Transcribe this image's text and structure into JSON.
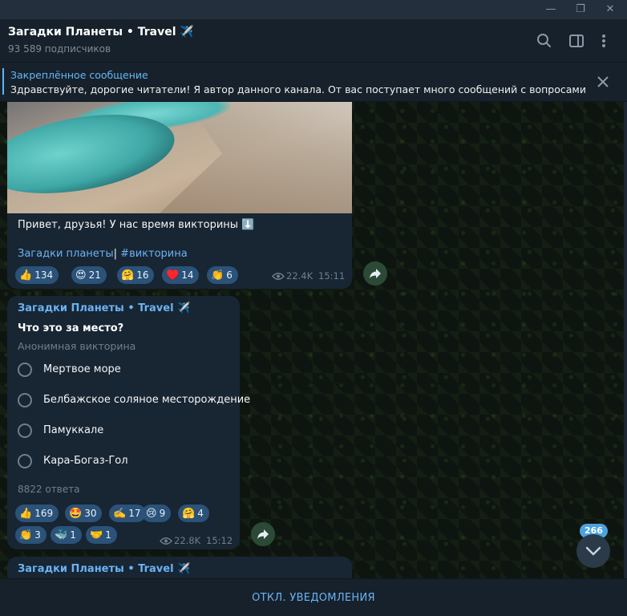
{
  "window": {
    "minimize": "—",
    "maximize": "❐",
    "close": "✕"
  },
  "header": {
    "title": "Загадки Планеты • Travel ✈️",
    "subtitle": "93 589 подписчиков"
  },
  "pinned": {
    "title": "Закреплённое сообщение",
    "text": "Здравствуйте, дорогие читатели! Я автор данного канала. От вас поступает много сообщений с вопросами к..."
  },
  "message1": {
    "text": "Привет, друзья! У нас время викторины ⬇️",
    "link1": "Загадки планеты",
    "separator": "|",
    "link2": "#викторина",
    "reactions": [
      {
        "emoji": "👍",
        "count": "134"
      },
      {
        "emoji": "😍",
        "count": "21"
      },
      {
        "emoji": "🤗",
        "count": "16"
      },
      {
        "emoji": "♥️",
        "count": "14"
      },
      {
        "emoji": "👏",
        "count": "6"
      }
    ],
    "views": "22.4K",
    "time": "15:11"
  },
  "message2": {
    "sender": "Загадки Планеты • Travel ✈️",
    "question": "Что это за место?",
    "quiz_type": "Анонимная викторина",
    "options": [
      "Мертвое море",
      "Белбажское соляное месторождение",
      "Памуккале",
      "Кара-Богаз-Гол"
    ],
    "answers": "8822 ответа",
    "reactions": [
      {
        "emoji": "👍",
        "count": "169"
      },
      {
        "emoji": "🤩",
        "count": "30"
      },
      {
        "emoji": "✍️",
        "count": "17"
      },
      {
        "emoji": "😢",
        "count": "9"
      },
      {
        "emoji": "🤗",
        "count": "4"
      },
      {
        "emoji": "👏",
        "count": "3"
      },
      {
        "emoji": "🐳",
        "count": "1"
      },
      {
        "emoji": "🤝",
        "count": "1"
      }
    ],
    "views": "22.8K",
    "time": "15:12"
  },
  "message3": {
    "sender": "Загадки Планеты • Travel ✈️"
  },
  "unread_badge": "266",
  "bottom": {
    "mute_label": "ОТКЛ. УВЕДОМЛЕНИЯ"
  },
  "colors": {
    "accent": "#6ab3f3",
    "bubble": "#182533",
    "reaction": "#2b5278"
  }
}
